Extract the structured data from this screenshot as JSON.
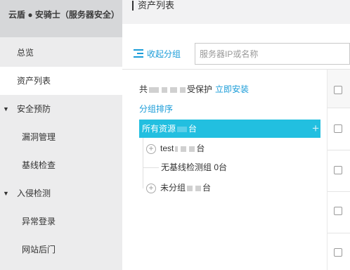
{
  "brand": "云盾 ● 安骑士（服务器安全）",
  "sidebar": {
    "items": [
      {
        "label": "总览",
        "type": "item"
      },
      {
        "label": "资产列表",
        "type": "item",
        "active": true
      },
      {
        "label": "安全预防",
        "type": "section",
        "expanded": true
      },
      {
        "label": "漏洞管理",
        "type": "subitem"
      },
      {
        "label": "基线检查",
        "type": "subitem"
      },
      {
        "label": "入侵检测",
        "type": "section",
        "expanded": true
      },
      {
        "label": "异常登录",
        "type": "subitem"
      },
      {
        "label": "网站后门",
        "type": "subitem"
      }
    ]
  },
  "main": {
    "title": "资产列表",
    "toolbar": {
      "collapse_label": "收起分组"
    },
    "search": {
      "placeholder": "服务器IP或名称"
    },
    "summary": {
      "prefix": "共",
      "suffix": "受保护",
      "install_link": "立即安装"
    },
    "sort_label": "分组排序",
    "groups": [
      {
        "label_prefix": "所有资源",
        "label_suffix": "台",
        "selected": true
      },
      {
        "label_prefix": "test",
        "label_suffix": "台",
        "expandable": true
      },
      {
        "label_prefix": "无基线检测组 0台",
        "label_suffix": "",
        "expandable": false
      },
      {
        "label_prefix": "未分组",
        "label_suffix": "台",
        "expandable": true
      }
    ],
    "add_group_icon": "plus-icon",
    "expand_icon": "plus-circle-icon"
  },
  "colors": {
    "accent": "#1a9cd8",
    "selected_row": "#22bfe0",
    "sidebar_bg": "#ececed"
  }
}
